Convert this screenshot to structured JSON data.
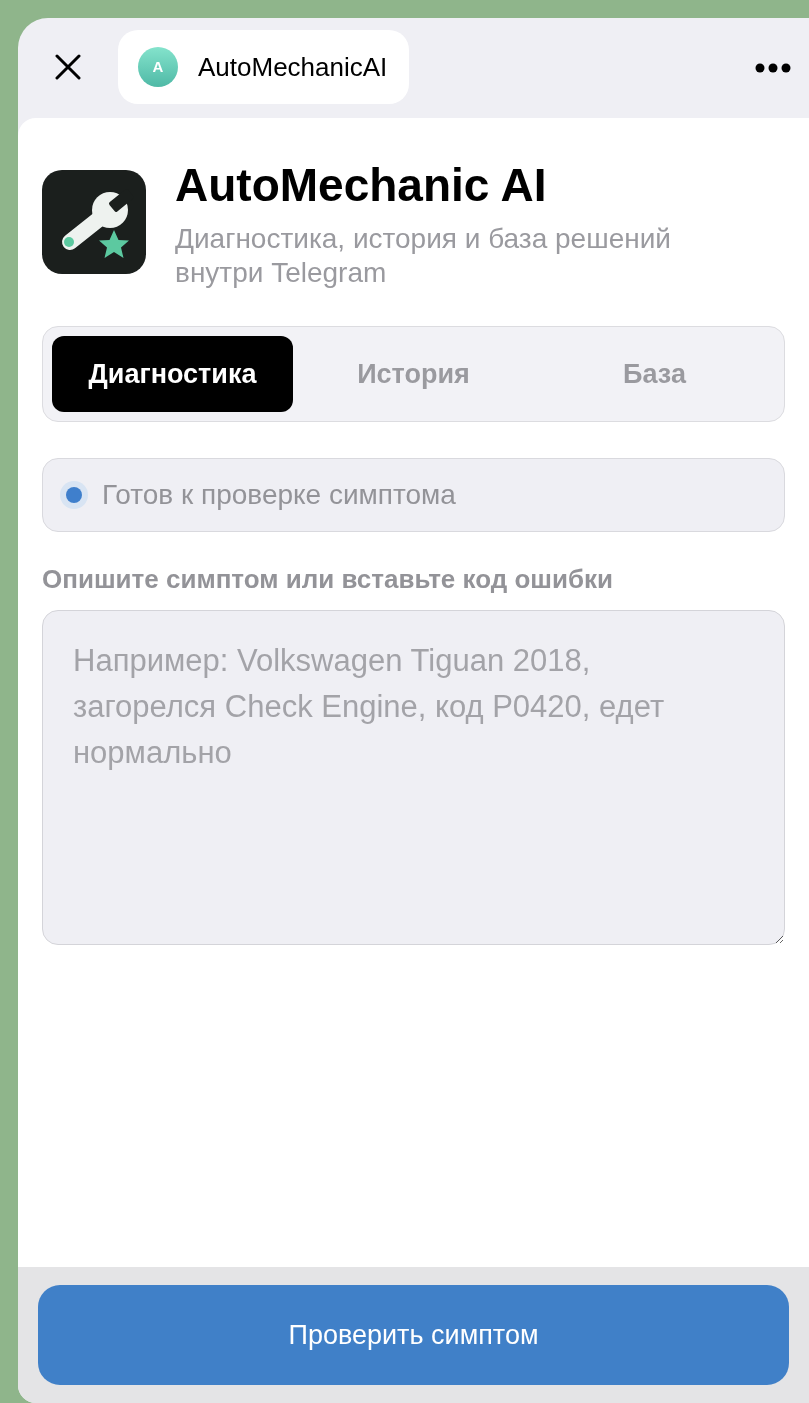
{
  "header": {
    "avatar_letter": "A",
    "title": "AutoMechanicAI"
  },
  "app": {
    "title": "AutoMechanic AI",
    "subtitle": "Диагностика, история и база решений внутри Telegram"
  },
  "tabs": [
    {
      "label": "Диагностика",
      "selected": true
    },
    {
      "label": "История",
      "selected": false
    },
    {
      "label": "База",
      "selected": false
    }
  ],
  "status": {
    "text": "Готов к проверке симптома"
  },
  "symptom": {
    "label": "Опишите симптом или вставьте код ошибки",
    "placeholder": "Например: Volkswagen Tiguan 2018, загорелся Check Engine, код P0420, едет нормально"
  },
  "main_button": {
    "label": "Проверить симптом"
  }
}
